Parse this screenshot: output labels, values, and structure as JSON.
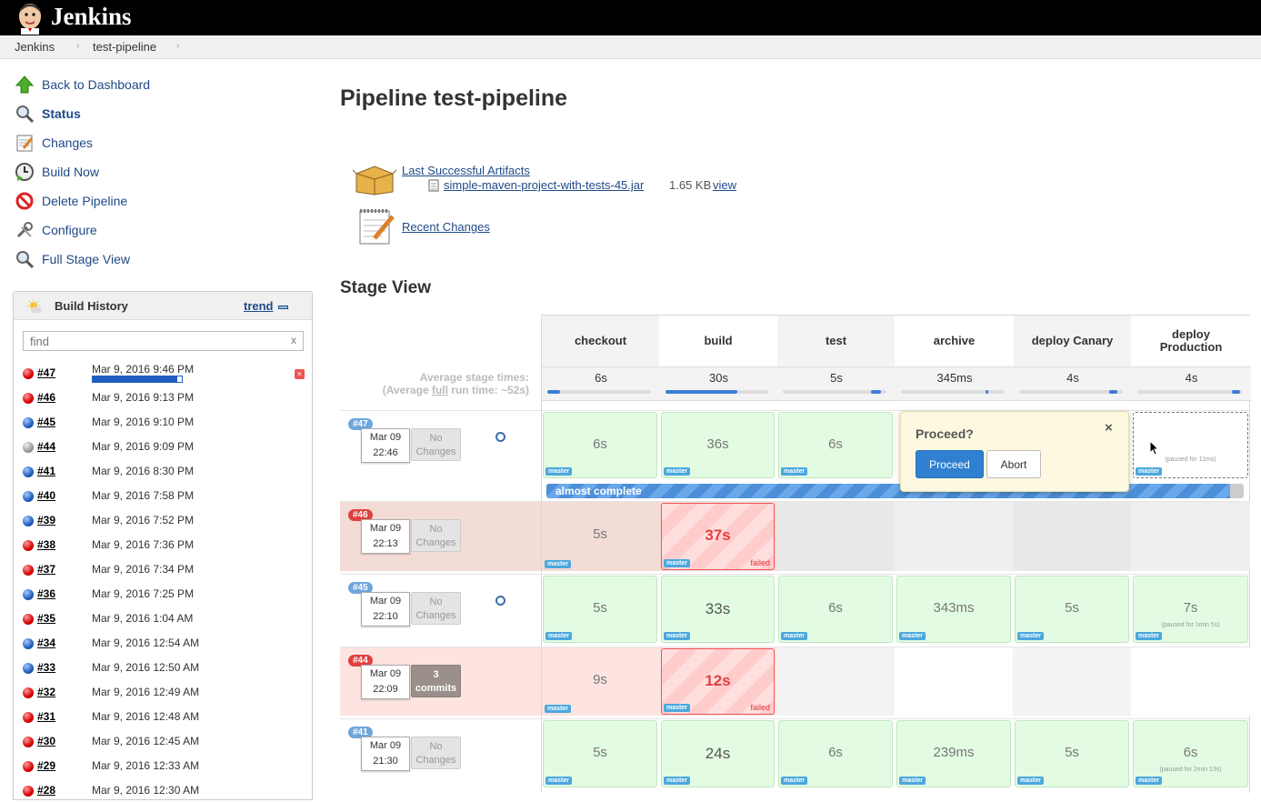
{
  "header": {
    "brand": "Jenkins",
    "logo_icon": "jenkins-butler-logo"
  },
  "breadcrumb": {
    "items": [
      "Jenkins",
      "test-pipeline"
    ],
    "sep": "›"
  },
  "sidebar": {
    "tasks": [
      {
        "label": "Back to Dashboard",
        "icon": "up-arrow-icon"
      },
      {
        "label": "Status",
        "icon": "magnifier-icon"
      },
      {
        "label": "Changes",
        "icon": "notepad-icon"
      },
      {
        "label": "Build Now",
        "icon": "clock-play-icon"
      },
      {
        "label": "Delete Pipeline",
        "icon": "no-entry-icon"
      },
      {
        "label": "Configure",
        "icon": "wrench-icon"
      },
      {
        "label": "Full Stage View",
        "icon": "magnifier-icon"
      }
    ]
  },
  "build_history": {
    "title": "Build History",
    "trend": "trend",
    "find_placeholder": "find",
    "clear": "x",
    "builds": [
      {
        "num": "#47",
        "date": "Mar 9, 2016 9:46 PM",
        "status": "red",
        "progress": 0.95
      },
      {
        "num": "#46",
        "date": "Mar 9, 2016 9:13 PM",
        "status": "red"
      },
      {
        "num": "#45",
        "date": "Mar 9, 2016 9:10 PM",
        "status": "blue"
      },
      {
        "num": "#44",
        "date": "Mar 9, 2016 9:09 PM",
        "status": "grey"
      },
      {
        "num": "#41",
        "date": "Mar 9, 2016 8:30 PM",
        "status": "blue"
      },
      {
        "num": "#40",
        "date": "Mar 9, 2016 7:58 PM",
        "status": "blue"
      },
      {
        "num": "#39",
        "date": "Mar 9, 2016 7:52 PM",
        "status": "blue"
      },
      {
        "num": "#38",
        "date": "Mar 9, 2016 7:36 PM",
        "status": "red"
      },
      {
        "num": "#37",
        "date": "Mar 9, 2016 7:34 PM",
        "status": "red"
      },
      {
        "num": "#36",
        "date": "Mar 9, 2016 7:25 PM",
        "status": "blue"
      },
      {
        "num": "#35",
        "date": "Mar 9, 2016 1:04 AM",
        "status": "red"
      },
      {
        "num": "#34",
        "date": "Mar 9, 2016 12:54 AM",
        "status": "blue"
      },
      {
        "num": "#33",
        "date": "Mar 9, 2016 12:50 AM",
        "status": "blue"
      },
      {
        "num": "#32",
        "date": "Mar 9, 2016 12:49 AM",
        "status": "red"
      },
      {
        "num": "#31",
        "date": "Mar 9, 2016 12:48 AM",
        "status": "red"
      },
      {
        "num": "#30",
        "date": "Mar 9, 2016 12:45 AM",
        "status": "red"
      },
      {
        "num": "#29",
        "date": "Mar 9, 2016 12:33 AM",
        "status": "red"
      },
      {
        "num": "#28",
        "date": "Mar 9, 2016 12:30 AM",
        "status": "red"
      }
    ]
  },
  "main": {
    "title": "Pipeline test-pipeline",
    "artifacts": {
      "label": "Last Successful Artifacts",
      "file": "simple-maven-project-with-tests-45.jar",
      "size": "1.65 KB",
      "view": "view"
    },
    "recent_changes": "Recent Changes",
    "stage_view_title": "Stage View"
  },
  "stage_view": {
    "avg_label_1": "Average stage times:",
    "avg_label_2_pre": "(Average ",
    "avg_label_2_link": "full",
    "avg_label_2_post": " run time: ~52s)",
    "stages": [
      {
        "name": "checkout",
        "avg": "6s",
        "avg_frac": 0.12
      },
      {
        "name": "build",
        "avg": "30s",
        "avg_frac": 0.7
      },
      {
        "name": "test",
        "avg": "5s",
        "avg_frac": 0.1
      },
      {
        "name": "archive",
        "avg": "345ms",
        "avg_frac": 0.02
      },
      {
        "name": "deploy Canary",
        "avg": "4s",
        "avg_frac": 0.08
      },
      {
        "name": "deploy Production",
        "avg": "4s",
        "avg_frac": 0.08
      }
    ],
    "runs": [
      {
        "badge": "#47",
        "month": "Mar 09",
        "time": "22:46",
        "changes": "No Changes",
        "cells": [
          "6s",
          "36s",
          "6s",
          "",
          "",
          ""
        ],
        "pending": "(paused for 11ms)"
      },
      {
        "badge": "#46",
        "month": "Mar 09",
        "time": "22:13",
        "changes": "No Changes",
        "cells": [
          "5s",
          "37s",
          "",
          "",
          "",
          ""
        ],
        "failed": "failed"
      },
      {
        "badge": "#45",
        "month": "Mar 09",
        "time": "22:10",
        "changes": "No Changes",
        "cells": [
          "5s",
          "33s",
          "6s",
          "343ms",
          "5s",
          "7s"
        ],
        "paused": "(paused for 1min 5s)"
      },
      {
        "badge": "#44",
        "month": "Mar 09",
        "time": "22:09",
        "changes": "3 commits",
        "cells": [
          "9s",
          "12s",
          "",
          "",
          "",
          ""
        ],
        "failed": "failed"
      },
      {
        "badge": "#41",
        "month": "Mar 09",
        "time": "21:30",
        "changes": "No Changes",
        "cells": [
          "5s",
          "24s",
          "6s",
          "239ms",
          "5s",
          "6s"
        ],
        "paused": "(paused for 2min 13s)"
      }
    ],
    "branch": "master",
    "progress_label": "almost complete",
    "progress": 0.98,
    "popup": {
      "question": "Proceed?",
      "close": "×",
      "proceed": "Proceed",
      "abort": "Abort"
    }
  }
}
